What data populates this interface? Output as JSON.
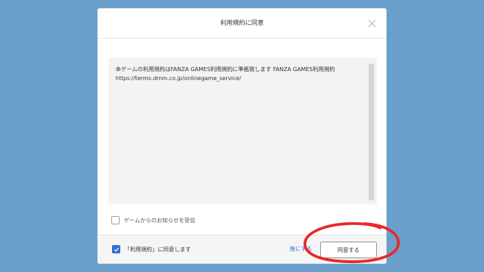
{
  "dialog": {
    "title": "利用規約に同意",
    "close_icon": "close-icon",
    "terms_text": "本ゲームの利用規約はFANZA GAMES利用規約に準拠致します FANZA GAMES利用規約\nhttps://terms.dmm.co.jp/onlinegame_service/",
    "notice_checkbox": {
      "label": "ゲームからのお知らせを受信",
      "checked": false
    },
    "agree_checkbox": {
      "label": "「利用規約」に同意します",
      "checked": true
    },
    "later_link": "後にする",
    "agree_button": "同意する"
  },
  "colors": {
    "background": "#6a9fcb",
    "accent": "#2d6fd6",
    "annotation": "#e8282a"
  }
}
